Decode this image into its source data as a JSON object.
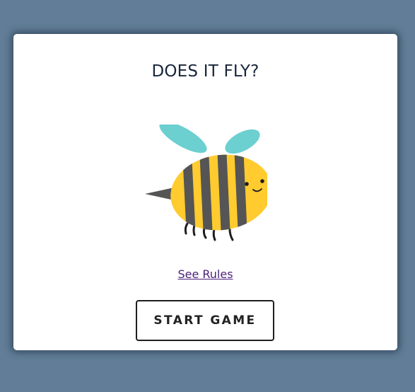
{
  "game": {
    "title": "DOES IT FLY?",
    "rules_link": "See Rules",
    "start_button": "START GAME",
    "mascot_icon": "bee-icon"
  },
  "colors": {
    "background": "#617d97",
    "card": "#ffffff",
    "title_text": "#18263a",
    "link": "#4b1f7a",
    "bee_body": "#ffcb2e",
    "bee_stripes": "#555555",
    "bee_wings": "#6ccfd0"
  }
}
